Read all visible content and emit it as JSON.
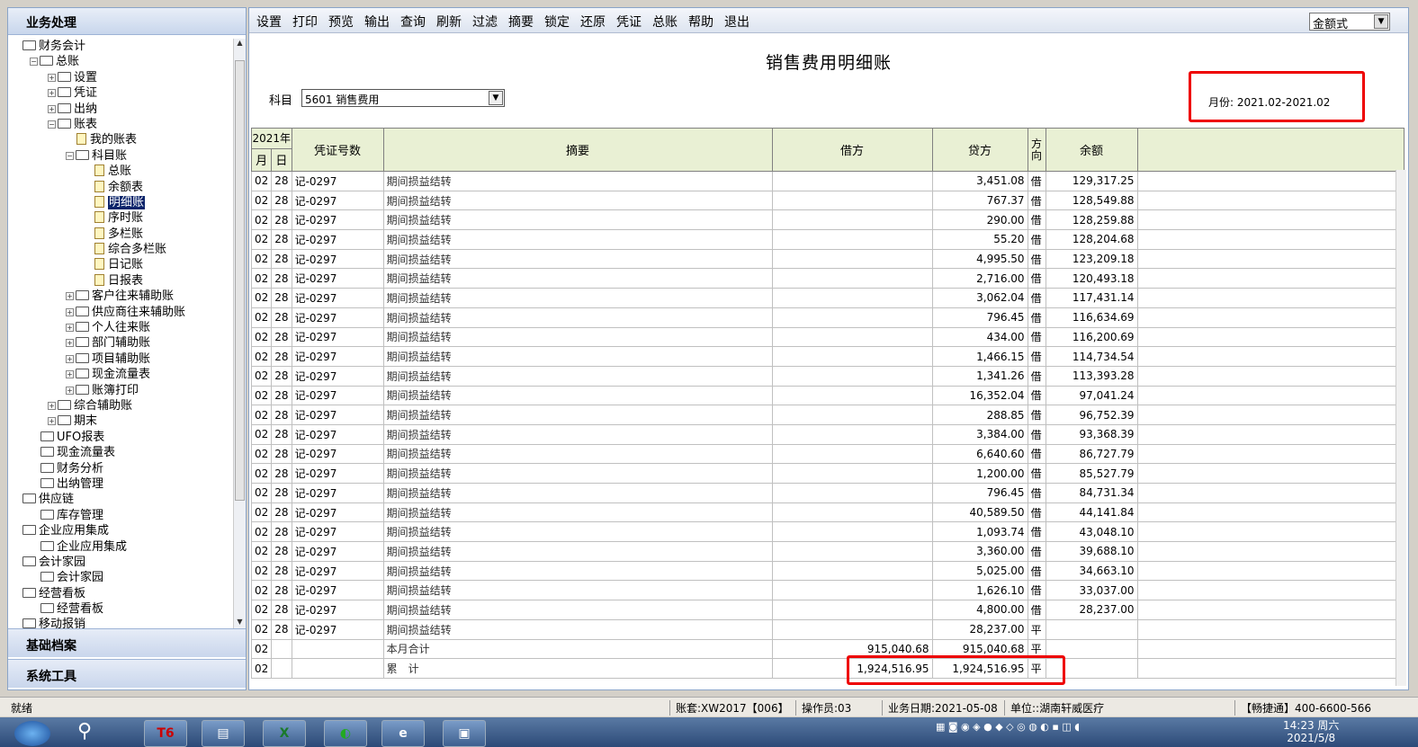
{
  "left_panel": {
    "header": "业务处理",
    "tree": [
      {
        "level": 0,
        "type": "folder",
        "label": "财务会计",
        "pm": ""
      },
      {
        "level": 1,
        "type": "folder",
        "label": "总账",
        "pm": "-"
      },
      {
        "level": 2,
        "type": "folder",
        "label": "设置",
        "pm": "+"
      },
      {
        "level": 2,
        "type": "folder",
        "label": "凭证",
        "pm": "+"
      },
      {
        "level": 2,
        "type": "folder",
        "label": "出纳",
        "pm": "+"
      },
      {
        "level": 2,
        "type": "folder",
        "label": "账表",
        "pm": "-"
      },
      {
        "level": 3,
        "type": "doc",
        "label": "我的账表",
        "pm": ""
      },
      {
        "level": 3,
        "type": "folder",
        "label": "科目账",
        "pm": "-"
      },
      {
        "level": 4,
        "type": "doc",
        "label": "总账",
        "pm": ""
      },
      {
        "level": 4,
        "type": "doc",
        "label": "余额表",
        "pm": ""
      },
      {
        "level": 4,
        "type": "doc",
        "label": "明细账",
        "pm": "",
        "selected": true
      },
      {
        "level": 4,
        "type": "doc",
        "label": "序时账",
        "pm": ""
      },
      {
        "level": 4,
        "type": "doc",
        "label": "多栏账",
        "pm": ""
      },
      {
        "level": 4,
        "type": "doc",
        "label": "综合多栏账",
        "pm": ""
      },
      {
        "level": 4,
        "type": "doc",
        "label": "日记账",
        "pm": ""
      },
      {
        "level": 4,
        "type": "doc",
        "label": "日报表",
        "pm": ""
      },
      {
        "level": 3,
        "type": "folder",
        "label": "客户往来辅助账",
        "pm": "+"
      },
      {
        "level": 3,
        "type": "folder",
        "label": "供应商往来辅助账",
        "pm": "+"
      },
      {
        "level": 3,
        "type": "folder",
        "label": "个人往来账",
        "pm": "+"
      },
      {
        "level": 3,
        "type": "folder",
        "label": "部门辅助账",
        "pm": "+"
      },
      {
        "level": 3,
        "type": "folder",
        "label": "项目辅助账",
        "pm": "+"
      },
      {
        "level": 3,
        "type": "folder",
        "label": "现金流量表",
        "pm": "+"
      },
      {
        "level": 3,
        "type": "folder",
        "label": "账簿打印",
        "pm": "+"
      },
      {
        "level": 2,
        "type": "folder",
        "label": "综合辅助账",
        "pm": "+"
      },
      {
        "level": 2,
        "type": "folder",
        "label": "期末",
        "pm": "+"
      },
      {
        "level": 1,
        "type": "folder",
        "label": "UFO报表",
        "pm": ""
      },
      {
        "level": 1,
        "type": "folder",
        "label": "现金流量表",
        "pm": ""
      },
      {
        "level": 1,
        "type": "folder",
        "label": "财务分析",
        "pm": ""
      },
      {
        "level": 1,
        "type": "folder",
        "label": "出纳管理",
        "pm": ""
      },
      {
        "level": 0,
        "type": "folder",
        "label": "供应链",
        "pm": ""
      },
      {
        "level": 1,
        "type": "folder",
        "label": "库存管理",
        "pm": ""
      },
      {
        "level": 0,
        "type": "folder",
        "label": "企业应用集成",
        "pm": ""
      },
      {
        "level": 1,
        "type": "folder",
        "label": "企业应用集成",
        "pm": ""
      },
      {
        "level": 0,
        "type": "folder",
        "label": "会计家园",
        "pm": ""
      },
      {
        "level": 1,
        "type": "folder",
        "label": "会计家园",
        "pm": ""
      },
      {
        "level": 0,
        "type": "folder",
        "label": "经营看板",
        "pm": ""
      },
      {
        "level": 1,
        "type": "folder",
        "label": "经营看板",
        "pm": ""
      },
      {
        "level": 0,
        "type": "folder",
        "label": "移动报销",
        "pm": ""
      }
    ],
    "bottom_buttons": [
      "基础档案",
      "系统工具"
    ]
  },
  "toolbar": {
    "items": [
      "设置",
      "打印",
      "预览",
      "输出",
      "查询",
      "刷新",
      "过滤",
      "摘要",
      "锁定",
      "还原",
      "凭证",
      "总账",
      "帮助",
      "退出"
    ],
    "mode_value": "金额式"
  },
  "report": {
    "title": "销售费用明细账",
    "subject_label": "科目",
    "subject_value": "5601 销售费用",
    "month_text": "月份: 2021.02-2021.02"
  },
  "table": {
    "header": {
      "year": "2021年",
      "month": "月",
      "day": "日",
      "voucher": "凭证号数",
      "summary": "摘要",
      "debit": "借方",
      "credit": "贷方",
      "direction": "方向",
      "balance": "余额"
    },
    "rows": [
      {
        "m": "02",
        "d": "28",
        "no": "记-0297",
        "sum": "期间损益结转",
        "dr": "",
        "cr": "3,451.08",
        "dir": "借",
        "bal": "129,317.25"
      },
      {
        "m": "02",
        "d": "28",
        "no": "记-0297",
        "sum": "期间损益结转",
        "dr": "",
        "cr": "767.37",
        "dir": "借",
        "bal": "128,549.88"
      },
      {
        "m": "02",
        "d": "28",
        "no": "记-0297",
        "sum": "期间损益结转",
        "dr": "",
        "cr": "290.00",
        "dir": "借",
        "bal": "128,259.88"
      },
      {
        "m": "02",
        "d": "28",
        "no": "记-0297",
        "sum": "期间损益结转",
        "dr": "",
        "cr": "55.20",
        "dir": "借",
        "bal": "128,204.68"
      },
      {
        "m": "02",
        "d": "28",
        "no": "记-0297",
        "sum": "期间损益结转",
        "dr": "",
        "cr": "4,995.50",
        "dir": "借",
        "bal": "123,209.18"
      },
      {
        "m": "02",
        "d": "28",
        "no": "记-0297",
        "sum": "期间损益结转",
        "dr": "",
        "cr": "2,716.00",
        "dir": "借",
        "bal": "120,493.18"
      },
      {
        "m": "02",
        "d": "28",
        "no": "记-0297",
        "sum": "期间损益结转",
        "dr": "",
        "cr": "3,062.04",
        "dir": "借",
        "bal": "117,431.14"
      },
      {
        "m": "02",
        "d": "28",
        "no": "记-0297",
        "sum": "期间损益结转",
        "dr": "",
        "cr": "796.45",
        "dir": "借",
        "bal": "116,634.69"
      },
      {
        "m": "02",
        "d": "28",
        "no": "记-0297",
        "sum": "期间损益结转",
        "dr": "",
        "cr": "434.00",
        "dir": "借",
        "bal": "116,200.69"
      },
      {
        "m": "02",
        "d": "28",
        "no": "记-0297",
        "sum": "期间损益结转",
        "dr": "",
        "cr": "1,466.15",
        "dir": "借",
        "bal": "114,734.54"
      },
      {
        "m": "02",
        "d": "28",
        "no": "记-0297",
        "sum": "期间损益结转",
        "dr": "",
        "cr": "1,341.26",
        "dir": "借",
        "bal": "113,393.28"
      },
      {
        "m": "02",
        "d": "28",
        "no": "记-0297",
        "sum": "期间损益结转",
        "dr": "",
        "cr": "16,352.04",
        "dir": "借",
        "bal": "97,041.24"
      },
      {
        "m": "02",
        "d": "28",
        "no": "记-0297",
        "sum": "期间损益结转",
        "dr": "",
        "cr": "288.85",
        "dir": "借",
        "bal": "96,752.39"
      },
      {
        "m": "02",
        "d": "28",
        "no": "记-0297",
        "sum": "期间损益结转",
        "dr": "",
        "cr": "3,384.00",
        "dir": "借",
        "bal": "93,368.39"
      },
      {
        "m": "02",
        "d": "28",
        "no": "记-0297",
        "sum": "期间损益结转",
        "dr": "",
        "cr": "6,640.60",
        "dir": "借",
        "bal": "86,727.79"
      },
      {
        "m": "02",
        "d": "28",
        "no": "记-0297",
        "sum": "期间损益结转",
        "dr": "",
        "cr": "1,200.00",
        "dir": "借",
        "bal": "85,527.79"
      },
      {
        "m": "02",
        "d": "28",
        "no": "记-0297",
        "sum": "期间损益结转",
        "dr": "",
        "cr": "796.45",
        "dir": "借",
        "bal": "84,731.34"
      },
      {
        "m": "02",
        "d": "28",
        "no": "记-0297",
        "sum": "期间损益结转",
        "dr": "",
        "cr": "40,589.50",
        "dir": "借",
        "bal": "44,141.84"
      },
      {
        "m": "02",
        "d": "28",
        "no": "记-0297",
        "sum": "期间损益结转",
        "dr": "",
        "cr": "1,093.74",
        "dir": "借",
        "bal": "43,048.10"
      },
      {
        "m": "02",
        "d": "28",
        "no": "记-0297",
        "sum": "期间损益结转",
        "dr": "",
        "cr": "3,360.00",
        "dir": "借",
        "bal": "39,688.10"
      },
      {
        "m": "02",
        "d": "28",
        "no": "记-0297",
        "sum": "期间损益结转",
        "dr": "",
        "cr": "5,025.00",
        "dir": "借",
        "bal": "34,663.10"
      },
      {
        "m": "02",
        "d": "28",
        "no": "记-0297",
        "sum": "期间损益结转",
        "dr": "",
        "cr": "1,626.10",
        "dir": "借",
        "bal": "33,037.00"
      },
      {
        "m": "02",
        "d": "28",
        "no": "记-0297",
        "sum": "期间损益结转",
        "dr": "",
        "cr": "4,800.00",
        "dir": "借",
        "bal": "28,237.00"
      },
      {
        "m": "02",
        "d": "28",
        "no": "记-0297",
        "sum": "期间损益结转",
        "dr": "",
        "cr": "28,237.00",
        "dir": "平",
        "bal": ""
      },
      {
        "m": "02",
        "d": "",
        "no": "",
        "sum": "本月合计",
        "dr": "915,040.68",
        "cr": "915,040.68",
        "dir": "平",
        "bal": ""
      },
      {
        "m": "02",
        "d": "",
        "no": "",
        "sum": "累　计",
        "dr": "1,924,516.95",
        "cr": "1,924,516.95",
        "dir": "平",
        "bal": ""
      }
    ]
  },
  "status": {
    "ready": "就绪",
    "account": "账套:XW2017【006】",
    "operator": "操作员:03",
    "biz_date": "业务日期:2021-05-08",
    "unit": "单位::湖南轩威医疗",
    "hotline": "【畅捷通】400-6600-566"
  },
  "taskbar": {
    "app_t6": "T6",
    "time": "14:23 周六",
    "date": "2021/5/8"
  },
  "colors": {
    "highlight": "#e00000",
    "header_bg": "#e9f0d4",
    "selection": "#0a246a"
  }
}
